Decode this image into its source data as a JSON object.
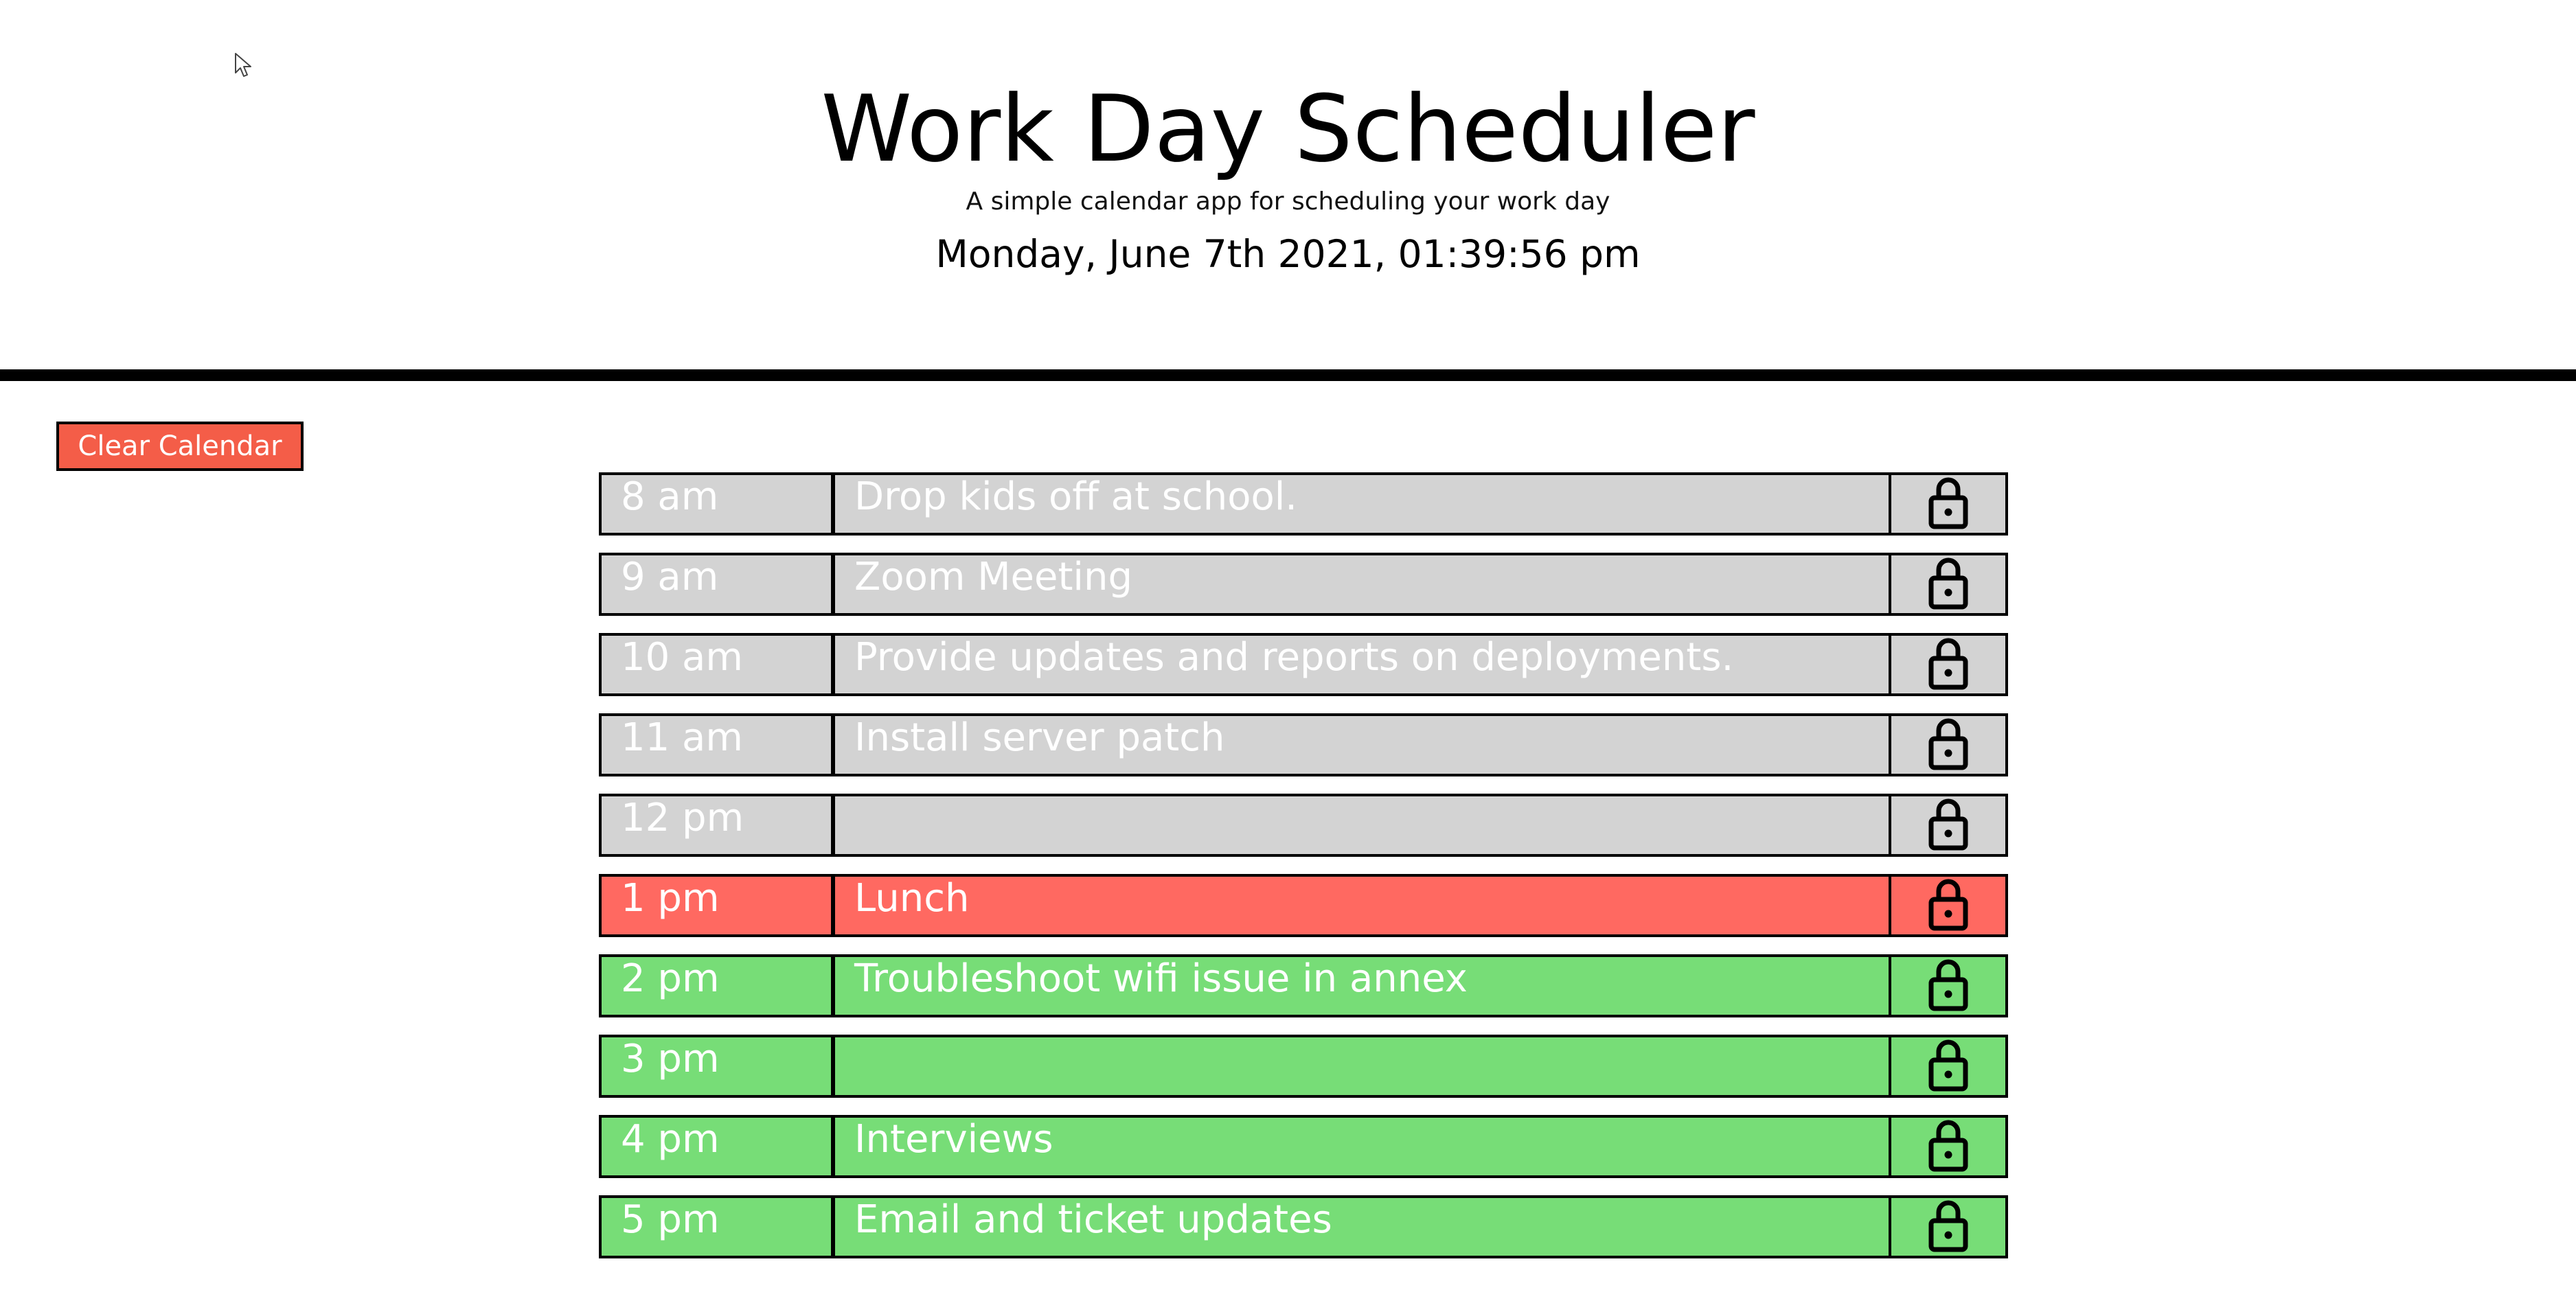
{
  "header": {
    "title": "Work Day Scheduler",
    "lead": "A simple calendar app for scheduling your work day",
    "current_day": "Monday, June 7th 2021, 01:39:56 pm"
  },
  "clear_button_label": "Clear Calendar",
  "colors": {
    "past": "#d3d3d3",
    "present": "#ff6961",
    "future": "#77dd77",
    "clear_button": "#f45d48"
  },
  "time_blocks": [
    {
      "hour": "8 am",
      "text": "Drop kids off at school.",
      "status": "past",
      "icon": "lock-icon"
    },
    {
      "hour": "9 am",
      "text": "Zoom Meeting",
      "status": "past",
      "icon": "lock-icon"
    },
    {
      "hour": "10 am",
      "text": "Provide updates and reports on deployments.",
      "status": "past",
      "icon": "lock-icon"
    },
    {
      "hour": "11 am",
      "text": "Install server patch",
      "status": "past",
      "icon": "lock-icon"
    },
    {
      "hour": "12 pm",
      "text": "",
      "status": "past",
      "icon": "lock-icon"
    },
    {
      "hour": "1 pm",
      "text": "Lunch",
      "status": "present",
      "icon": "lock-icon"
    },
    {
      "hour": "2 pm",
      "text": "Troubleshoot wifi issue in annex",
      "status": "future",
      "icon": "lock-icon"
    },
    {
      "hour": "3 pm",
      "text": "",
      "status": "future",
      "icon": "lock-icon"
    },
    {
      "hour": "4 pm",
      "text": "Interviews",
      "status": "future",
      "icon": "lock-icon"
    },
    {
      "hour": "5 pm",
      "text": "Email and ticket updates",
      "status": "future",
      "icon": "lock-icon"
    }
  ]
}
